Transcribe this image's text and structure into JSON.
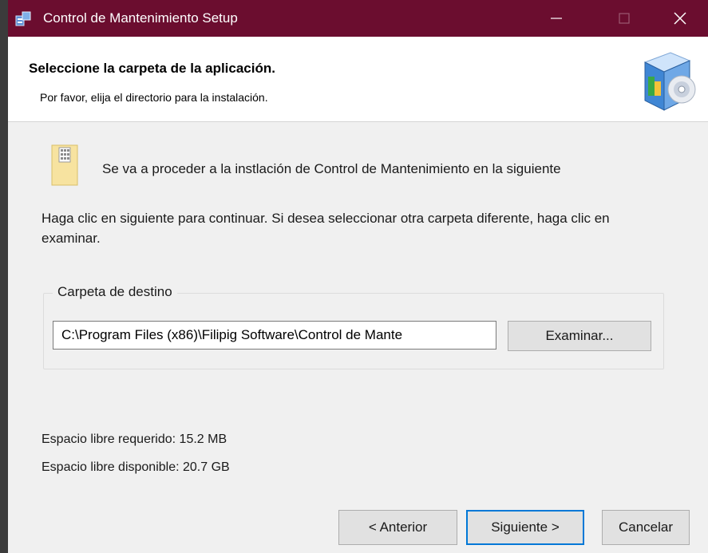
{
  "window": {
    "title": "Control de Mantenimiento Setup",
    "controls": {
      "minimize": "minimize-icon",
      "maximize": "maximize-icon",
      "close": "close-icon"
    },
    "titlebar_color": "#6b0d2f"
  },
  "header": {
    "title": "Seleccione la carpeta de la aplicación.",
    "subtitle": "Por favor, elija el directorio para la instalación.",
    "icon": "installer-box-cd-icon"
  },
  "content": {
    "intro": "Se va a proceder a la instlación de Control de Mantenimiento en la siguiente",
    "instructions": "Haga clic en siguiente para continuar. Si desea seleccionar otra carpeta diferente, haga clic en examinar.",
    "destination": {
      "label": "Carpeta de destino",
      "path": "C:\\Program Files (x86)\\Filipig Software\\Control de Mante",
      "browse_label": "Examinar..."
    },
    "space_required": "Espacio libre requerido: 15.2 MB",
    "space_available": "Espacio libre disponible: 20.7 GB"
  },
  "footer": {
    "back_label": "< Anterior",
    "next_label": "Siguiente >",
    "cancel_label": "Cancelar"
  }
}
